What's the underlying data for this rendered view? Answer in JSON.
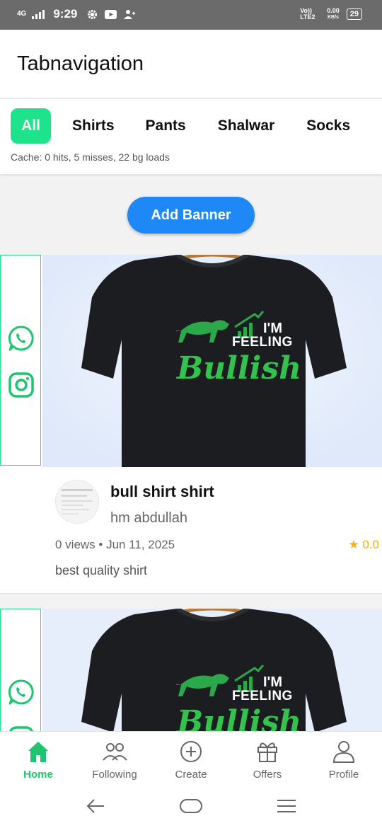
{
  "status_bar": {
    "time": "9:29",
    "network": "4G",
    "net_speed": "0.00",
    "net_speed_unit": "KB/s",
    "volte": "Vo)) LTE2",
    "battery": "29",
    "icons": [
      "signal-icon",
      "gear-icon",
      "youtube-icon",
      "person-add-icon"
    ]
  },
  "app_bar": {
    "title": "Tabnavigation"
  },
  "tabs": {
    "items": [
      {
        "label": "All",
        "active": true
      },
      {
        "label": "Shirts",
        "active": false
      },
      {
        "label": "Pants",
        "active": false
      },
      {
        "label": "Shalwar",
        "active": false
      },
      {
        "label": "Socks",
        "active": false
      }
    ],
    "cache_text": "Cache: 0 hits, 5 misses, 22 bg loads",
    "accent_color": "#1ee38c"
  },
  "add_banner_label": "Add Banner",
  "posts": [
    {
      "banner_line1": "I'M",
      "banner_line2": "FEELING",
      "banner_line3": "Bullish",
      "title": "bull shirt shirt",
      "author": "hm abdullah",
      "meta": "0 views • Jun 11, 2025",
      "rating": "★ 0.0",
      "description": "best quality shirt",
      "social_icons": [
        "whatsapp-icon",
        "instagram-icon"
      ]
    },
    {
      "banner_line1": "I'M",
      "banner_line2": "FEELING",
      "banner_line3": "Bullish",
      "social_icons": [
        "whatsapp-icon",
        "instagram-icon"
      ]
    }
  ],
  "bottom_nav": {
    "items": [
      {
        "label": "Home",
        "icon": "home-icon",
        "active": true
      },
      {
        "label": "Following",
        "icon": "people-icon",
        "active": false
      },
      {
        "label": "Create",
        "icon": "plus-circle-icon",
        "active": false
      },
      {
        "label": "Offers",
        "icon": "gift-icon",
        "active": false
      },
      {
        "label": "Profile",
        "icon": "person-icon",
        "active": false
      }
    ],
    "active_color": "#1ec46e"
  },
  "system_nav": [
    "back-icon",
    "home-pill-icon",
    "menu-icon"
  ]
}
